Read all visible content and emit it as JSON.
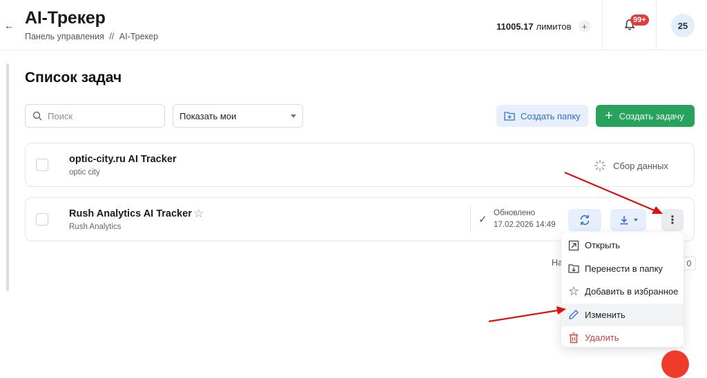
{
  "header": {
    "title": "AI-Трекер",
    "breadcrumb": [
      "Панель управления",
      "//",
      "AI-Трекер"
    ],
    "limits_value": "11005.17",
    "limits_label": "лимитов",
    "notif_badge": "99+",
    "avatar_text": "25"
  },
  "main": {
    "section_title": "Список задач",
    "search_placeholder": "Поиск",
    "filter_selected": "Показать мои",
    "create_folder_label": "Создать папку",
    "create_task_label": "Создать задачу"
  },
  "tasks": [
    {
      "title": "optic-city.ru AI Tracker",
      "subtitle": "optic city",
      "status": "Сбор данных"
    },
    {
      "title": "Rush Analytics AI Tracker",
      "subtitle": "Rush Analytics",
      "updated_label": "Обновлено",
      "updated_date": "17.02.2026 14:49"
    }
  ],
  "pager": {
    "label": "Ha",
    "end": "0"
  },
  "context_menu": [
    {
      "label": "Открыть",
      "icon": "open-external-icon"
    },
    {
      "label": "Перенести в папку",
      "icon": "move-folder-icon"
    },
    {
      "label": "Добавить в избранное",
      "icon": "star-icon"
    },
    {
      "label": "Изменить",
      "icon": "pencil-icon"
    },
    {
      "label": "Удалить",
      "icon": "trash-icon"
    }
  ],
  "colors": {
    "accent_green": "#27a35c",
    "accent_blue": "#2f6fd6",
    "highlight_yellow": "#ffd43b",
    "danger_red": "#d93b3b",
    "annotation_arrow": "#e01010"
  }
}
